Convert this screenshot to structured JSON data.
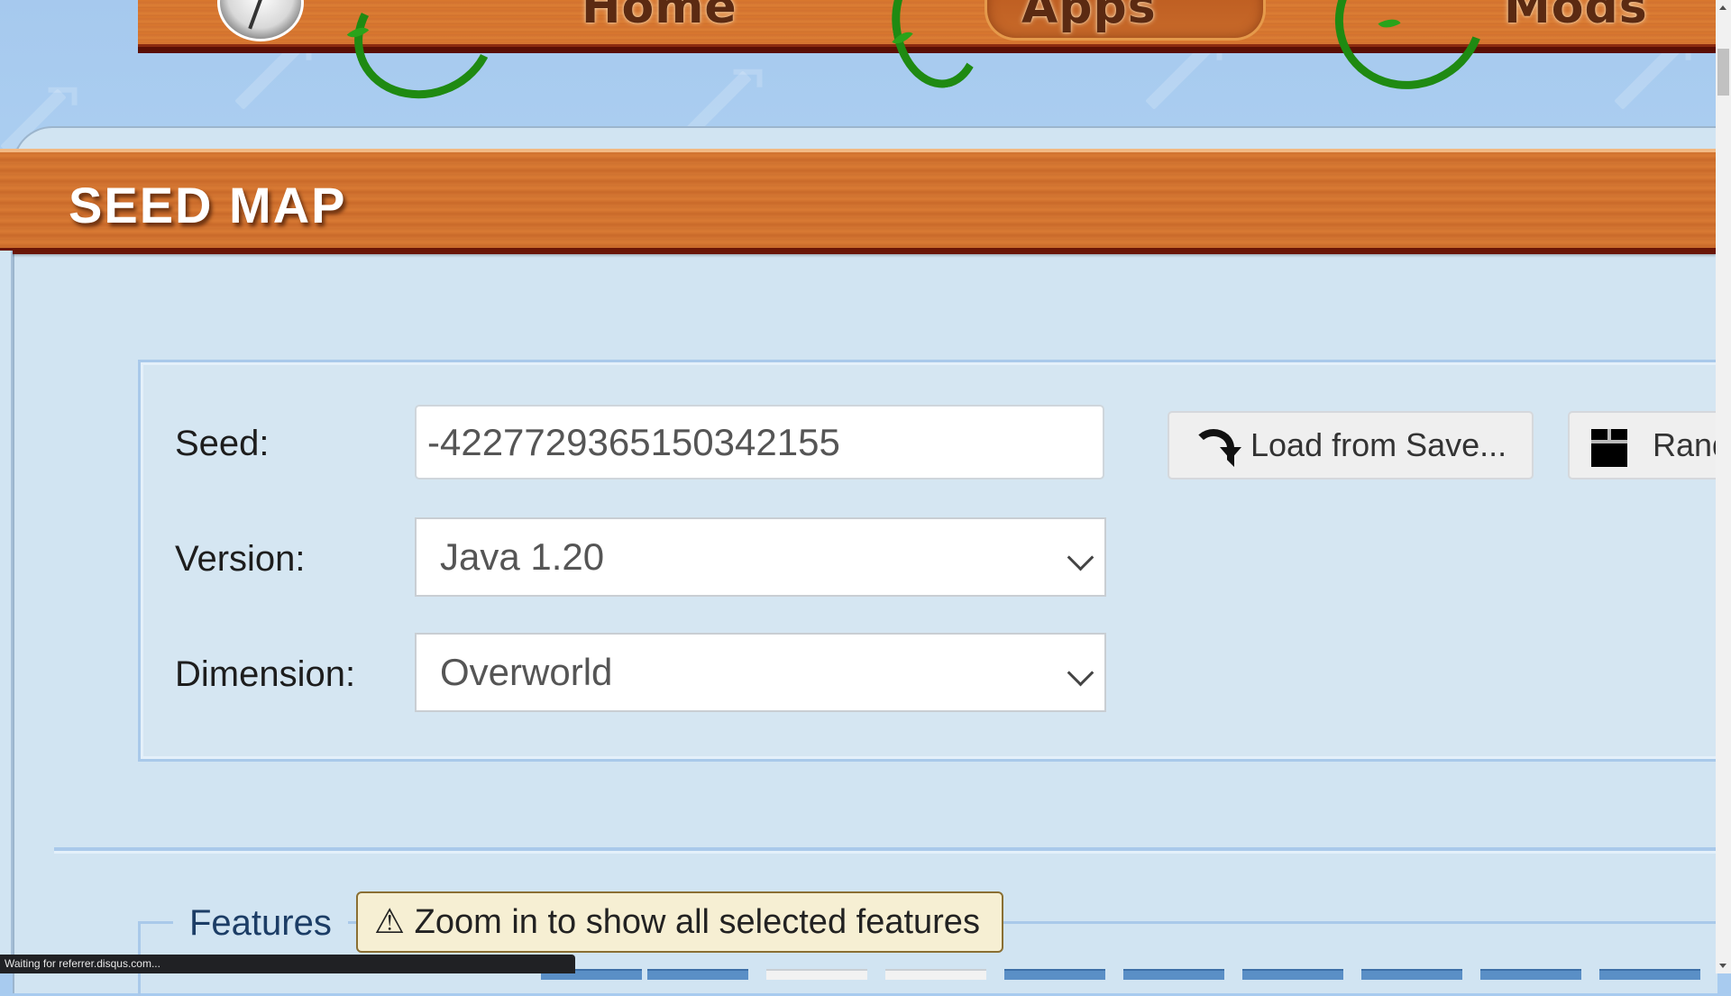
{
  "nav": {
    "items": [
      {
        "label": "Home"
      },
      {
        "label": "Apps",
        "active": true
      },
      {
        "label": "Mods"
      }
    ],
    "logo_icon": "globe-logo-icon"
  },
  "page": {
    "title": "SEED MAP"
  },
  "form": {
    "seed_label": "Seed:",
    "seed_value": "-4227729365150342155",
    "version_label": "Version:",
    "version_value": "Java 1.20",
    "dimension_label": "Dimension:",
    "dimension_value": "Overworld",
    "load_button": {
      "label": "Load from Save...",
      "icon": "redo-arrow-icon"
    },
    "random_button": {
      "label": "Random",
      "icon": "gift-box-icon"
    }
  },
  "features": {
    "legend": "Features",
    "warning": "⚠ Zoom in to show all selected features",
    "tiles": [
      {
        "selected": true
      },
      {
        "selected": true
      },
      {
        "selected": false
      },
      {
        "selected": false
      },
      {
        "selected": true
      },
      {
        "selected": true
      },
      {
        "selected": true
      },
      {
        "selected": true
      },
      {
        "selected": true
      },
      {
        "selected": true
      }
    ]
  },
  "status_bar": {
    "text": "Waiting for referrer.disqus.com..."
  },
  "colors": {
    "wood": "#d47632",
    "wood_dark": "#5a0f05",
    "sky": "#a8cbef",
    "panel": "#d1e4f2",
    "legend_text": "#1c3d66",
    "warning_bg": "#f6efd3",
    "tile_selected": "#5a8fc6"
  }
}
